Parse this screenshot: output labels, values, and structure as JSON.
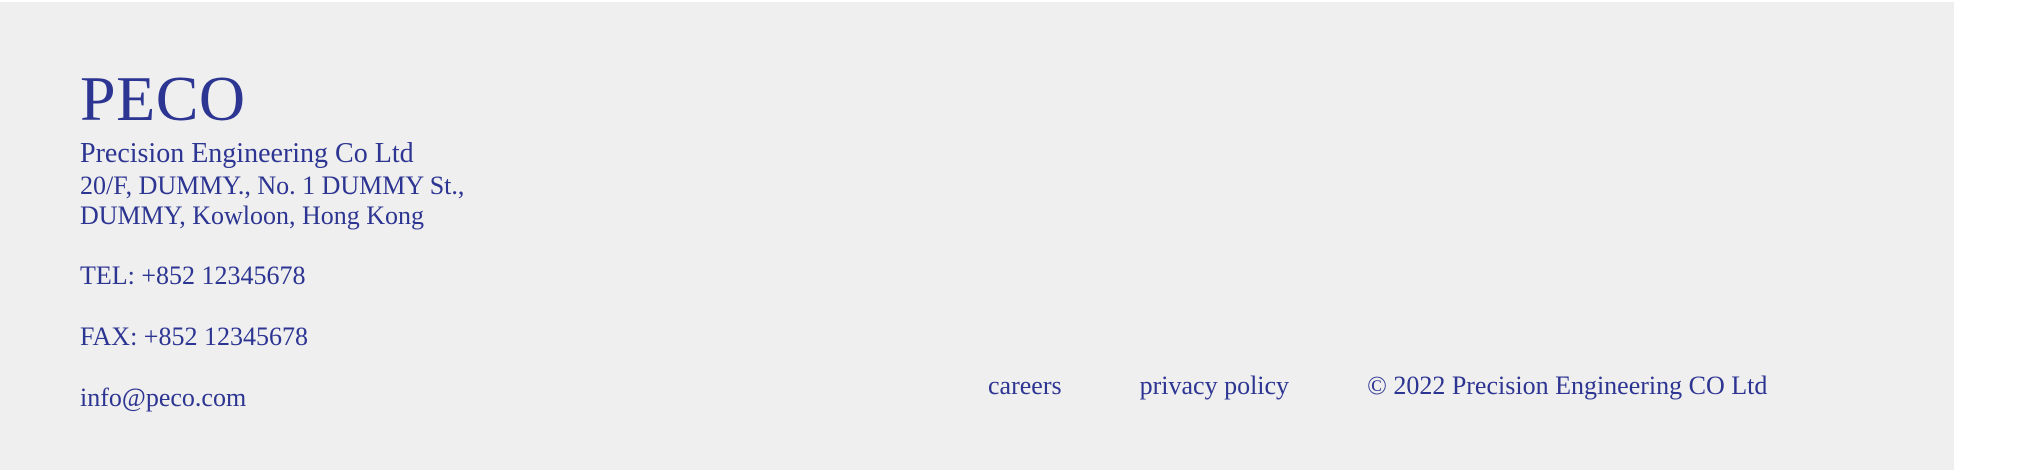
{
  "footer": {
    "brand": "PECO",
    "company_name": "Precision Engineering Co Ltd",
    "address_line1": "20/F, DUMMY., No. 1 DUMMY St.,",
    "address_line2": "DUMMY, Kowloon, Hong Kong",
    "tel": "TEL: +852 12345678",
    "fax": "FAX: +852 12345678",
    "email": "info@peco.com",
    "links": {
      "careers": "careers",
      "privacy_policy": "privacy policy"
    },
    "copyright": "© 2022 Precision Engineering CO Ltd"
  },
  "colors": {
    "text": "#2d3592",
    "background": "#efefef"
  }
}
